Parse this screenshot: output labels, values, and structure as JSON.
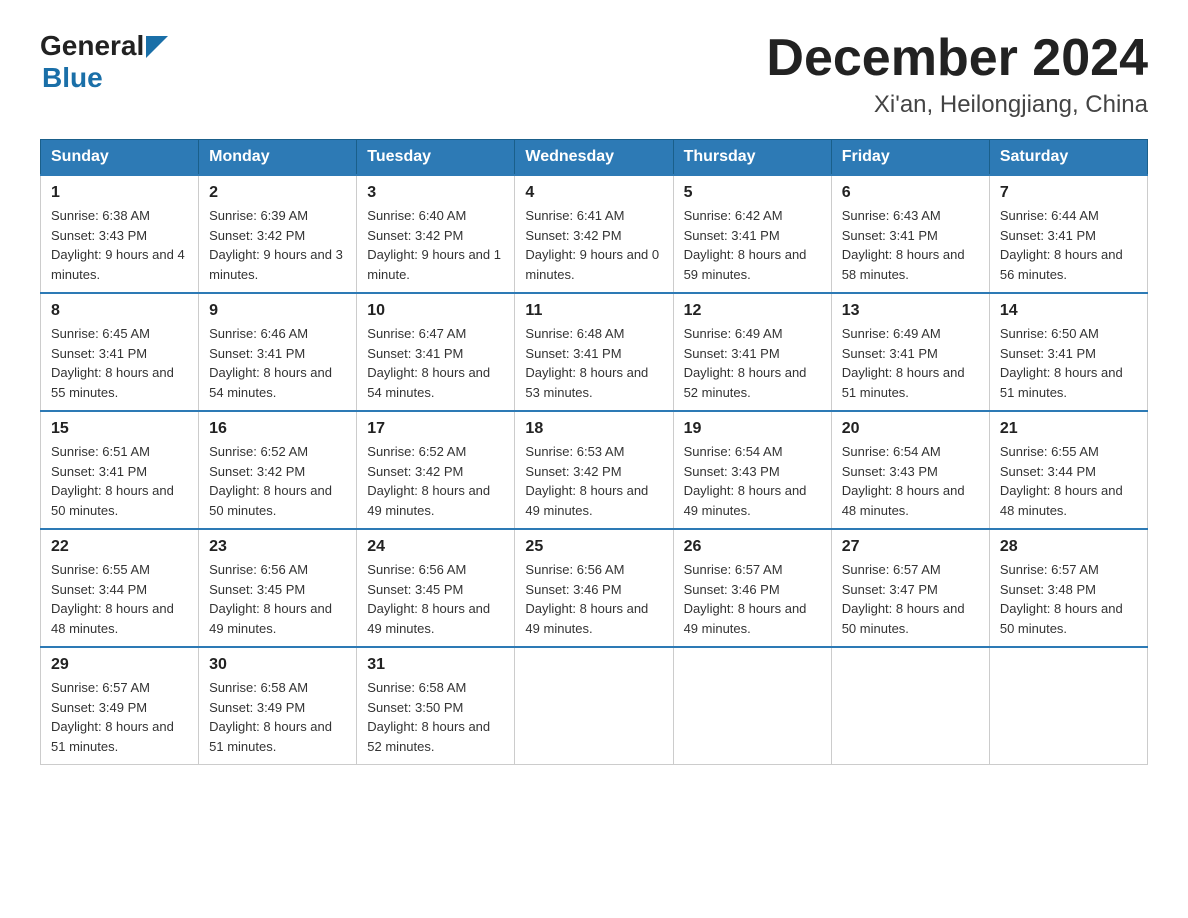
{
  "logo": {
    "general": "General",
    "blue": "Blue"
  },
  "title": "December 2024",
  "subtitle": "Xi'an, Heilongjiang, China",
  "weekdays": [
    "Sunday",
    "Monday",
    "Tuesday",
    "Wednesday",
    "Thursday",
    "Friday",
    "Saturday"
  ],
  "weeks": [
    [
      {
        "day": "1",
        "sunrise": "6:38 AM",
        "sunset": "3:43 PM",
        "daylight": "9 hours and 4 minutes."
      },
      {
        "day": "2",
        "sunrise": "6:39 AM",
        "sunset": "3:42 PM",
        "daylight": "9 hours and 3 minutes."
      },
      {
        "day": "3",
        "sunrise": "6:40 AM",
        "sunset": "3:42 PM",
        "daylight": "9 hours and 1 minute."
      },
      {
        "day": "4",
        "sunrise": "6:41 AM",
        "sunset": "3:42 PM",
        "daylight": "9 hours and 0 minutes."
      },
      {
        "day": "5",
        "sunrise": "6:42 AM",
        "sunset": "3:41 PM",
        "daylight": "8 hours and 59 minutes."
      },
      {
        "day": "6",
        "sunrise": "6:43 AM",
        "sunset": "3:41 PM",
        "daylight": "8 hours and 58 minutes."
      },
      {
        "day": "7",
        "sunrise": "6:44 AM",
        "sunset": "3:41 PM",
        "daylight": "8 hours and 56 minutes."
      }
    ],
    [
      {
        "day": "8",
        "sunrise": "6:45 AM",
        "sunset": "3:41 PM",
        "daylight": "8 hours and 55 minutes."
      },
      {
        "day": "9",
        "sunrise": "6:46 AM",
        "sunset": "3:41 PM",
        "daylight": "8 hours and 54 minutes."
      },
      {
        "day": "10",
        "sunrise": "6:47 AM",
        "sunset": "3:41 PM",
        "daylight": "8 hours and 54 minutes."
      },
      {
        "day": "11",
        "sunrise": "6:48 AM",
        "sunset": "3:41 PM",
        "daylight": "8 hours and 53 minutes."
      },
      {
        "day": "12",
        "sunrise": "6:49 AM",
        "sunset": "3:41 PM",
        "daylight": "8 hours and 52 minutes."
      },
      {
        "day": "13",
        "sunrise": "6:49 AM",
        "sunset": "3:41 PM",
        "daylight": "8 hours and 51 minutes."
      },
      {
        "day": "14",
        "sunrise": "6:50 AM",
        "sunset": "3:41 PM",
        "daylight": "8 hours and 51 minutes."
      }
    ],
    [
      {
        "day": "15",
        "sunrise": "6:51 AM",
        "sunset": "3:41 PM",
        "daylight": "8 hours and 50 minutes."
      },
      {
        "day": "16",
        "sunrise": "6:52 AM",
        "sunset": "3:42 PM",
        "daylight": "8 hours and 50 minutes."
      },
      {
        "day": "17",
        "sunrise": "6:52 AM",
        "sunset": "3:42 PM",
        "daylight": "8 hours and 49 minutes."
      },
      {
        "day": "18",
        "sunrise": "6:53 AM",
        "sunset": "3:42 PM",
        "daylight": "8 hours and 49 minutes."
      },
      {
        "day": "19",
        "sunrise": "6:54 AM",
        "sunset": "3:43 PM",
        "daylight": "8 hours and 49 minutes."
      },
      {
        "day": "20",
        "sunrise": "6:54 AM",
        "sunset": "3:43 PM",
        "daylight": "8 hours and 48 minutes."
      },
      {
        "day": "21",
        "sunrise": "6:55 AM",
        "sunset": "3:44 PM",
        "daylight": "8 hours and 48 minutes."
      }
    ],
    [
      {
        "day": "22",
        "sunrise": "6:55 AM",
        "sunset": "3:44 PM",
        "daylight": "8 hours and 48 minutes."
      },
      {
        "day": "23",
        "sunrise": "6:56 AM",
        "sunset": "3:45 PM",
        "daylight": "8 hours and 49 minutes."
      },
      {
        "day": "24",
        "sunrise": "6:56 AM",
        "sunset": "3:45 PM",
        "daylight": "8 hours and 49 minutes."
      },
      {
        "day": "25",
        "sunrise": "6:56 AM",
        "sunset": "3:46 PM",
        "daylight": "8 hours and 49 minutes."
      },
      {
        "day": "26",
        "sunrise": "6:57 AM",
        "sunset": "3:46 PM",
        "daylight": "8 hours and 49 minutes."
      },
      {
        "day": "27",
        "sunrise": "6:57 AM",
        "sunset": "3:47 PM",
        "daylight": "8 hours and 50 minutes."
      },
      {
        "day": "28",
        "sunrise": "6:57 AM",
        "sunset": "3:48 PM",
        "daylight": "8 hours and 50 minutes."
      }
    ],
    [
      {
        "day": "29",
        "sunrise": "6:57 AM",
        "sunset": "3:49 PM",
        "daylight": "8 hours and 51 minutes."
      },
      {
        "day": "30",
        "sunrise": "6:58 AM",
        "sunset": "3:49 PM",
        "daylight": "8 hours and 51 minutes."
      },
      {
        "day": "31",
        "sunrise": "6:58 AM",
        "sunset": "3:50 PM",
        "daylight": "8 hours and 52 minutes."
      },
      null,
      null,
      null,
      null
    ]
  ]
}
